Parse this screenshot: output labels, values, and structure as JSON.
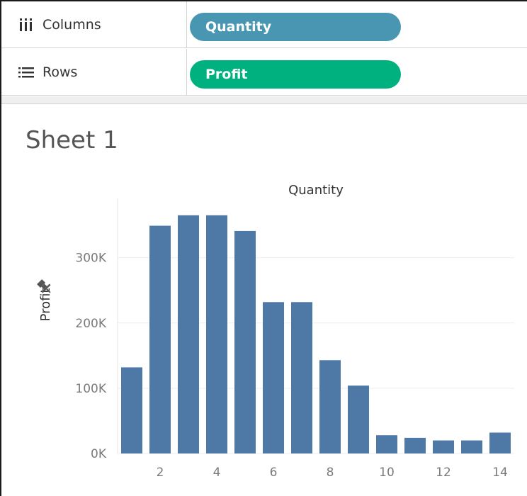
{
  "shelves": {
    "columns": {
      "label": "Columns",
      "icon": "columns-icon",
      "pill": "Quantity",
      "pill_color": "#4996b2"
    },
    "rows": {
      "label": "Rows",
      "icon": "rows-icon",
      "pill": "Profit",
      "pill_color": "#00b180"
    }
  },
  "sheet": {
    "title": "Sheet 1"
  },
  "chart_data": {
    "type": "bar",
    "x_title": "Quantity",
    "y_title": "Profit",
    "categories": [
      1,
      2,
      3,
      4,
      5,
      6,
      7,
      8,
      9,
      10,
      11,
      12,
      13,
      14
    ],
    "values": [
      132000,
      349000,
      365000,
      365000,
      341000,
      232000,
      232000,
      143000,
      104000,
      28000,
      24000,
      20000,
      20000,
      32000
    ],
    "ylim": [
      0,
      380000
    ],
    "y_ticks": [
      0,
      100000,
      200000,
      300000
    ],
    "y_tick_labels": [
      "0K",
      "100K",
      "200K",
      "300K"
    ],
    "x_ticks": [
      2,
      4,
      6,
      8,
      10,
      12,
      14
    ],
    "bar_color": "#4e79a7",
    "grid": true,
    "pinned_axis_icon": "pin-icon"
  }
}
